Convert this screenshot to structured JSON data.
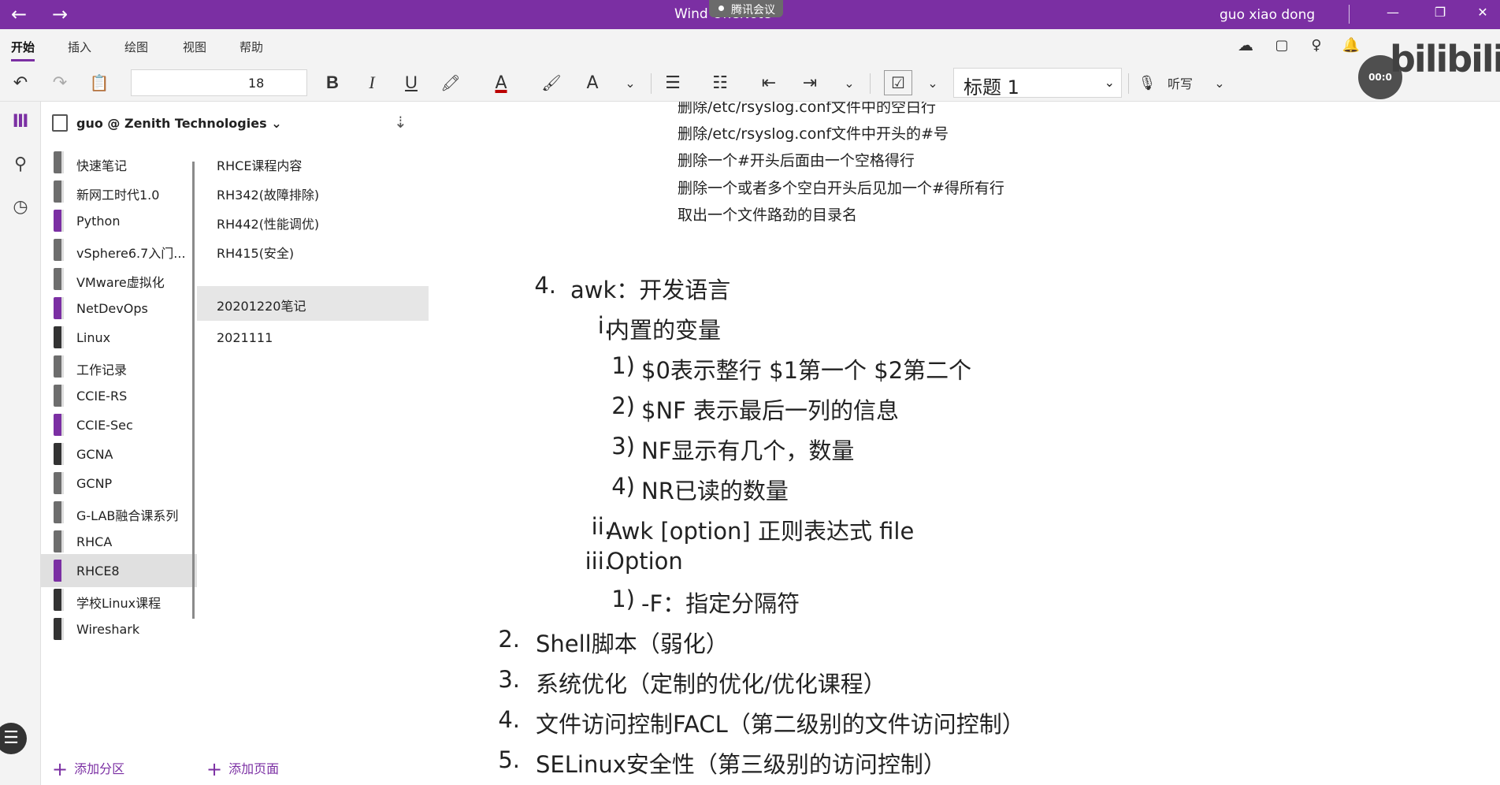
{
  "titlebar": {
    "title": "Wind       OneNote",
    "meeting_badge": "腾讯会议",
    "user": "guo xiao dong",
    "minimize": "—",
    "restore": "❐",
    "close": "✕"
  },
  "menu": {
    "tabs": [
      "开始",
      "插入",
      "绘图",
      "视图",
      "帮助"
    ]
  },
  "toolbar": {
    "font_size": "18",
    "bold": "B",
    "italic": "I",
    "underline": "U",
    "style": "标题 1",
    "dictate": "听写"
  },
  "notebook": {
    "name": "guo @ Zenith Technologies"
  },
  "sections": [
    {
      "label": "快速笔记",
      "color": "#6d6d6d"
    },
    {
      "label": "新网工时代1.0",
      "color": "#6d6d6d"
    },
    {
      "label": "Python",
      "color": "#7b2fa3"
    },
    {
      "label": "vSphere6.7入门...",
      "color": "#6d6d6d"
    },
    {
      "label": "VMware虚拟化",
      "color": "#6d6d6d"
    },
    {
      "label": "NetDevOps",
      "color": "#7b2fa3"
    },
    {
      "label": "Linux",
      "color": "#333333"
    },
    {
      "label": "工作记录",
      "color": "#6d6d6d"
    },
    {
      "label": "CCIE-RS",
      "color": "#6d6d6d"
    },
    {
      "label": "CCIE-Sec",
      "color": "#7b2fa3"
    },
    {
      "label": "GCNA",
      "color": "#333333"
    },
    {
      "label": "GCNP",
      "color": "#6d6d6d"
    },
    {
      "label": "G-LAB融合课系列",
      "color": "#6d6d6d"
    },
    {
      "label": "RHCA",
      "color": "#6d6d6d"
    },
    {
      "label": "RHCE8",
      "color": "#7b2fa3"
    },
    {
      "label": "学校Linux课程",
      "color": "#333333"
    },
    {
      "label": "Wireshark",
      "color": "#333333"
    }
  ],
  "pages": [
    "RHCE课程内容",
    "RH342(故障排除)",
    "RH442(性能调优)",
    "RH415(安全)",
    "20201220笔记",
    "2021111"
  ],
  "add_section": "添加分区",
  "add_page": "添加页面",
  "note": {
    "top_lines": [
      "删除/etc/rsyslog.conf文件中的空白行",
      "删除/etc/rsyslog.conf文件中开头的#号",
      "删除一个#开头后面由一个空格得行",
      "删除一个或者多个空白开头后见加一个#得所有行",
      "取出一个文件路劲的目录名"
    ],
    "awk": {
      "num": "4.",
      "text": "awk：开发语言"
    },
    "awk_i": {
      "num": "i.",
      "text": "内置的变量"
    },
    "vars": [
      {
        "num": "1)",
        "text": "$0表示整行 $1第一个 $2第二个"
      },
      {
        "num": "2)",
        "text": "$NF 表示最后一列的信息"
      },
      {
        "num": "3)",
        "text": "NF显示有几个，数量"
      },
      {
        "num": "4)",
        "text": "NR已读的数量"
      }
    ],
    "awk_ii": {
      "num": "ii.",
      "text": "Awk [option] 正则表达式 file"
    },
    "awk_iii": {
      "num": "iii.",
      "text": "Option"
    },
    "opt1": {
      "num": "1)",
      "text": "-F：指定分隔符"
    },
    "main": [
      {
        "num": "2.",
        "text": "Shell脚本（弱化）"
      },
      {
        "num": "3.",
        "text": "系统优化（定制的优化/优化课程）"
      },
      {
        "num": "4.",
        "text": "文件访问控制FACL（第二级别的文件访问控制）"
      },
      {
        "num": "5.",
        "text": "SELinux安全性（第三级别的访问控制）"
      }
    ]
  },
  "watermark": {
    "brand": "bilibili",
    "time": "00:0"
  }
}
